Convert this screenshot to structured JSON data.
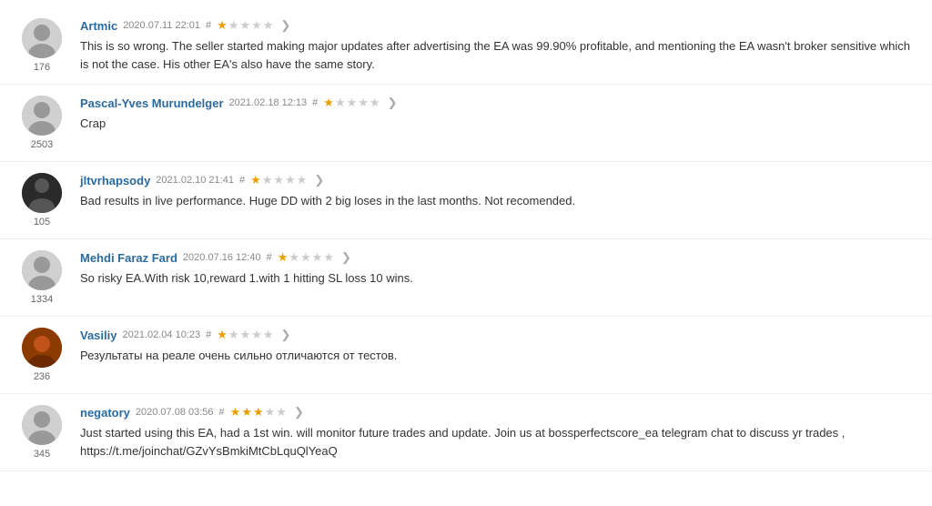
{
  "reviews": [
    {
      "id": "artmic",
      "name": "Artmic",
      "date": "2020.07.11 22:01",
      "hash": "#",
      "stars": [
        true,
        false,
        false,
        false,
        false
      ],
      "count": "176",
      "text": "This is so wrong. The seller started making major updates after advertising the EA was 99.90% profitable, and mentioning the EA wasn't broker sensitive which is not the case. His other EA's also have the same story.",
      "avatarType": "default"
    },
    {
      "id": "pascal-yves",
      "name": "Pascal-Yves Murundelger",
      "date": "2021.02.18 12:13",
      "hash": "#",
      "stars": [
        true,
        false,
        false,
        false,
        false
      ],
      "count": "2503",
      "text": "Crap",
      "avatarType": "default"
    },
    {
      "id": "jltvrhapsody",
      "name": "jltvrhapsody",
      "date": "2021.02.10 21:41",
      "hash": "#",
      "stars": [
        true,
        false,
        false,
        false,
        false
      ],
      "count": "105",
      "text": "Bad results in live performance. Huge DD with 2 big loses in the last months. Not recomended.",
      "avatarType": "dark"
    },
    {
      "id": "mehdi-faraz-fard",
      "name": "Mehdi Faraz Fard",
      "date": "2020.07.16 12:40",
      "hash": "#",
      "stars": [
        true,
        false,
        false,
        false,
        false
      ],
      "count": "1334",
      "text": "So risky EA.With risk 10,reward 1.with 1 hitting SL loss 10 wins.",
      "avatarType": "default"
    },
    {
      "id": "vasiliy",
      "name": "Vasiliy",
      "date": "2021.02.04 10:23",
      "hash": "#",
      "stars": [
        true,
        false,
        false,
        false,
        false
      ],
      "count": "236",
      "text": "Результаты на реале очень сильно отличаются от тестов.",
      "avatarType": "orange"
    },
    {
      "id": "negatory",
      "name": "negatory",
      "date": "2020.07.08 03:56",
      "hash": "#",
      "stars": [
        true,
        true,
        true,
        false,
        false
      ],
      "count": "345",
      "text": "Just started using this EA, had a 1st win. will monitor future trades and update. Join us at bossperfectscore_ea telegram chat to discuss yr trades ,\nhttps://t.me/joinchat/GZvYsBmkiMtCbLquQlYeaQ",
      "avatarType": "default"
    }
  ],
  "other_label": "other"
}
